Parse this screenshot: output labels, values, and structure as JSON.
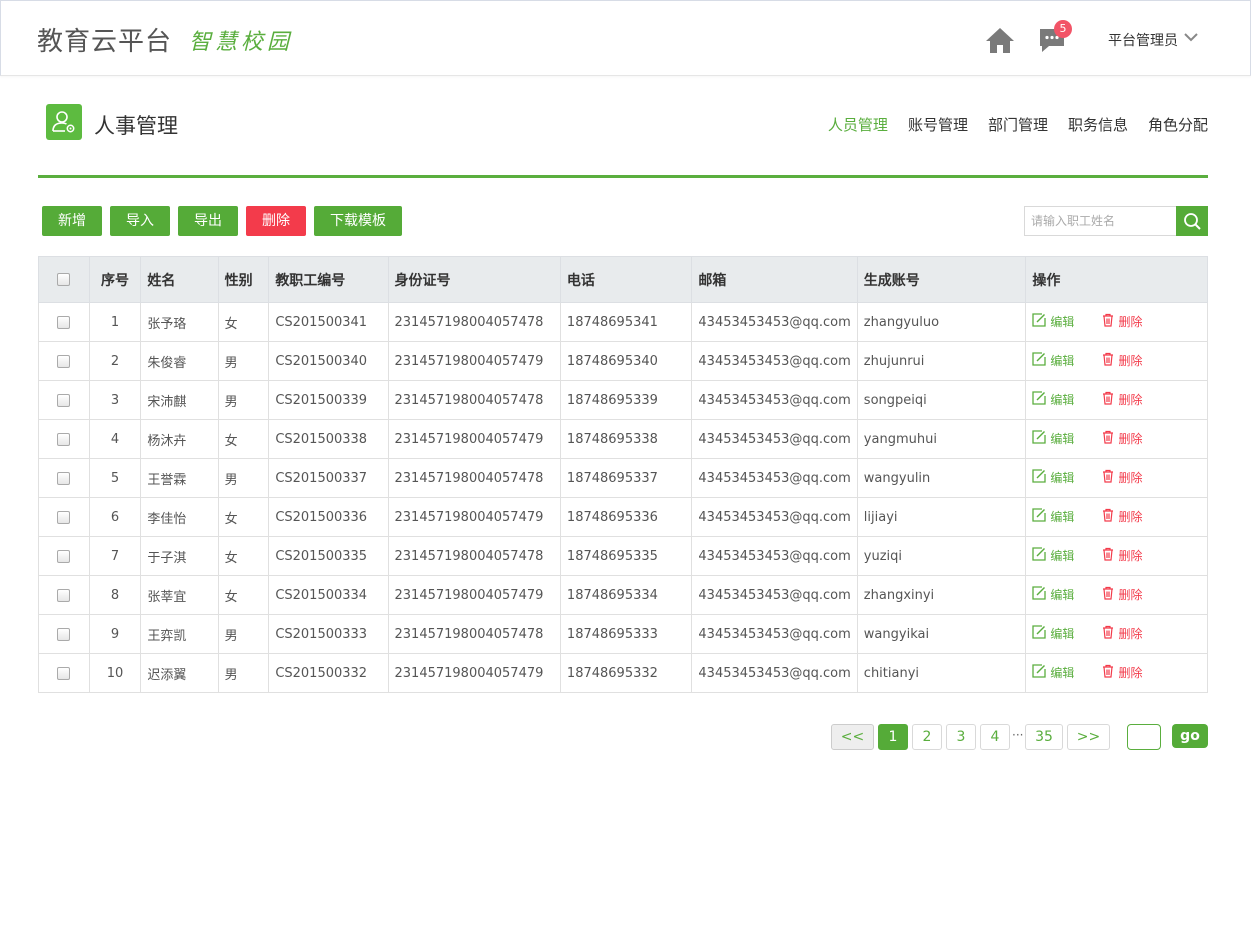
{
  "header": {
    "brand": "教育云平台",
    "brand_sub": "智慧校园",
    "badge_count": "5",
    "user": "平台管理员"
  },
  "page": {
    "title": "人事管理",
    "tabs": [
      {
        "label": "人员管理",
        "active": true
      },
      {
        "label": "账号管理"
      },
      {
        "label": "部门管理"
      },
      {
        "label": "职务信息"
      },
      {
        "label": "角色分配"
      }
    ]
  },
  "toolbar": {
    "add": "新增",
    "import": "导入",
    "export": "导出",
    "delete": "删除",
    "template": "下载模板",
    "search_placeholder": "请输入职工姓名"
  },
  "table": {
    "columns": [
      "序号",
      "姓名",
      "性别",
      "教职工编号",
      "身份证号",
      "电话",
      "邮箱",
      "生成账号",
      "操作"
    ],
    "edit_label": "编辑",
    "delete_label": "删除",
    "rows": [
      [
        "1",
        "张予珞",
        "女",
        "CS201500341",
        "231457198004057478",
        "18748695341",
        "43453453453@qq.com",
        "zhangyuluo"
      ],
      [
        "2",
        "朱俊睿",
        "男",
        "CS201500340",
        "231457198004057479",
        "18748695340",
        "43453453453@qq.com",
        "zhujunrui"
      ],
      [
        "3",
        "宋沛麒",
        "男",
        "CS201500339",
        "231457198004057478",
        "18748695339",
        "43453453453@qq.com",
        "songpeiqi"
      ],
      [
        "4",
        "杨沐卉",
        "女",
        "CS201500338",
        "231457198004057479",
        "18748695338",
        "43453453453@qq.com",
        "yangmuhui"
      ],
      [
        "5",
        "王誉霖",
        "男",
        "CS201500337",
        "231457198004057478",
        "18748695337",
        "43453453453@qq.com",
        "wangyulin"
      ],
      [
        "6",
        "李佳怡",
        "女",
        "CS201500336",
        "231457198004057479",
        "18748695336",
        "43453453453@qq.com",
        "lijiayi"
      ],
      [
        "7",
        "于子淇",
        "女",
        "CS201500335",
        "231457198004057478",
        "18748695335",
        "43453453453@qq.com",
        "yuziqi"
      ],
      [
        "8",
        "张莘宜",
        "女",
        "CS201500334",
        "231457198004057479",
        "18748695334",
        "43453453453@qq.com",
        "zhangxinyi"
      ],
      [
        "9",
        "王弈凯",
        "男",
        "CS201500333",
        "231457198004057478",
        "18748695333",
        "43453453453@qq.com",
        "wangyikai"
      ],
      [
        "10",
        "迟添翼",
        "男",
        "CS201500332",
        "231457198004057479",
        "18748695332",
        "43453453453@qq.com",
        "chitianyi"
      ]
    ]
  },
  "pager": {
    "prev": "<<",
    "pages": [
      "1",
      "2",
      "3",
      "4"
    ],
    "dots": "···",
    "last": "35",
    "next": ">>",
    "go": "go"
  },
  "colors": {
    "accent": "#55ab38",
    "danger": "#f33b4b",
    "badge": "#f25467"
  }
}
